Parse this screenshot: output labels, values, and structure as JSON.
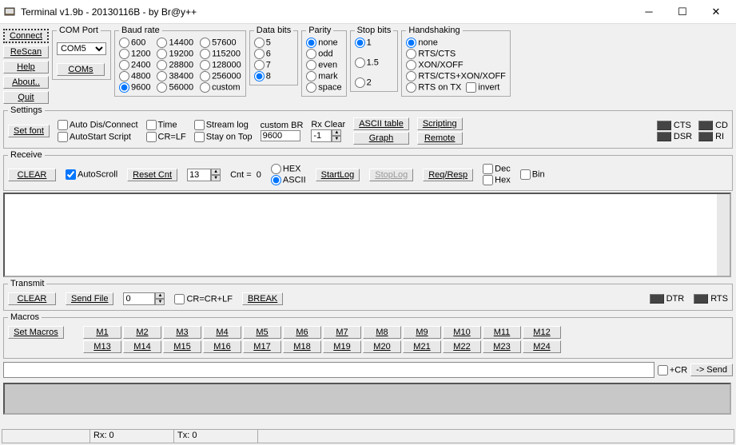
{
  "title": "Terminal v1.9b - 20130116B - by Br@y++",
  "controls": {
    "connect": "Connect",
    "rescan": "ReScan",
    "help": "Help",
    "about": "About..",
    "quit": "Quit"
  },
  "comport": {
    "legend": "COM Port",
    "selected": "COM5",
    "coms_btn": "COMs"
  },
  "baud": {
    "legend": "Baud rate",
    "options": [
      "600",
      "1200",
      "2400",
      "4800",
      "9600",
      "14400",
      "19200",
      "28800",
      "38400",
      "56000",
      "57600",
      "115200",
      "128000",
      "256000",
      "custom"
    ],
    "selected": "9600"
  },
  "databits": {
    "legend": "Data bits",
    "options": [
      "5",
      "6",
      "7",
      "8"
    ],
    "selected": "8"
  },
  "parity": {
    "legend": "Parity",
    "options": [
      "none",
      "odd",
      "even",
      "mark",
      "space"
    ],
    "selected": "none"
  },
  "stopbits": {
    "legend": "Stop bits",
    "options": [
      "1",
      "1.5",
      "2"
    ],
    "selected": "1"
  },
  "handshaking": {
    "legend": "Handshaking",
    "options": [
      "none",
      "RTS/CTS",
      "XON/XOFF",
      "RTS/CTS+XON/XOFF"
    ],
    "selected": "none",
    "rts_on_tx": "RTS on TX",
    "invert": "invert"
  },
  "settings": {
    "legend": "Settings",
    "setfont": "Set font",
    "auto_dis": "Auto Dis/Connect",
    "autostart": "AutoStart Script",
    "time": "Time",
    "crlf": "CR=LF",
    "streamlog": "Stream log",
    "stayontop": "Stay on Top",
    "custom_br_label": "custom BR",
    "custom_br_value": "9600",
    "rx_clear": "Rx Clear",
    "rx_clear_value": "-1",
    "ascii_table": "ASCII table",
    "graph": "Graph",
    "scripting": "Scripting",
    "remote": "Remote"
  },
  "leds_top": [
    "CTS",
    "CD",
    "DSR",
    "RI"
  ],
  "receive": {
    "legend": "Receive",
    "clear": "CLEAR",
    "autoscroll": "AutoScroll",
    "resetcnt": "Reset Cnt",
    "cnt_spin": "13",
    "cnt_label": "Cnt = ",
    "cnt_value": "0",
    "hex": "HEX",
    "ascii": "ASCII",
    "startlog": "StartLog",
    "stoplog": "StopLog",
    "reqresp": "Req/Resp",
    "dec": "Dec",
    "hexchk": "Hex",
    "bin": "Bin"
  },
  "transmit": {
    "legend": "Transmit",
    "clear": "CLEAR",
    "sendfile": "Send File",
    "spin": "0",
    "crcrlf": "CR=CR+LF",
    "break": "BREAK"
  },
  "leds_tx": [
    "DTR",
    "RTS"
  ],
  "macros": {
    "legend": "Macros",
    "set": "Set Macros",
    "row1": [
      "M1",
      "M2",
      "M3",
      "M4",
      "M5",
      "M6",
      "M7",
      "M8",
      "M9",
      "M10",
      "M11",
      "M12"
    ],
    "row2": [
      "M13",
      "M14",
      "M15",
      "M16",
      "M17",
      "M18",
      "M19",
      "M20",
      "M21",
      "M22",
      "M23",
      "M24"
    ]
  },
  "send": {
    "cr": "+CR",
    "send": "-> Send"
  },
  "status": {
    "rx": "Rx: 0",
    "tx": "Tx: 0"
  }
}
